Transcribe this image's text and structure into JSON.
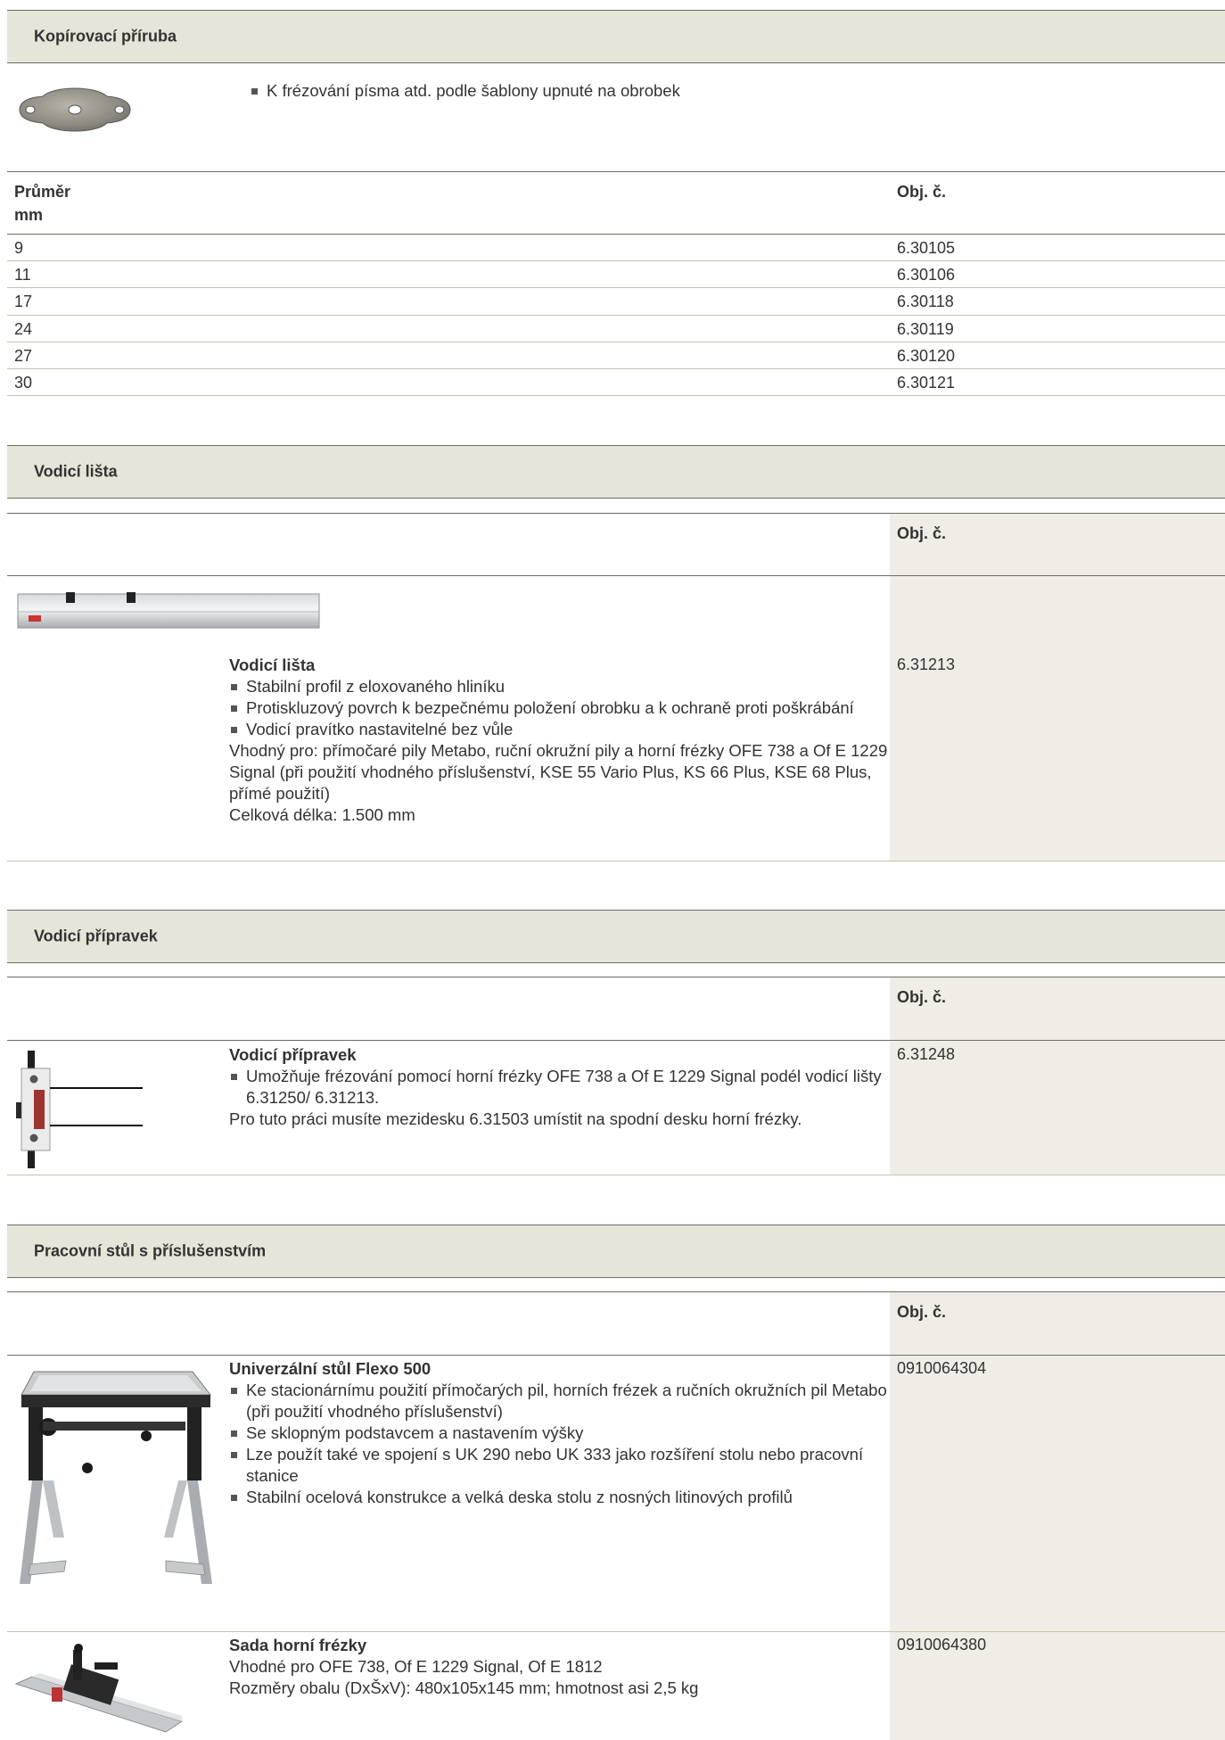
{
  "sections": {
    "copy_flange": {
      "title": "Kopírovací příruba",
      "bullet": "K frézování písma atd. podle šablony upnuté na obrobek",
      "table": {
        "headers": [
          "Průměr\nmm",
          "Obj. č."
        ],
        "header_diameter_line1": "Průměr",
        "header_diameter_line2": "mm",
        "header_order": "Obj. č.",
        "rows": [
          {
            "diameter": "9",
            "order": "6.30105"
          },
          {
            "diameter": "11",
            "order": "6.30106"
          },
          {
            "diameter": "17",
            "order": "6.30118"
          },
          {
            "diameter": "24",
            "order": "6.30119"
          },
          {
            "diameter": "27",
            "order": "6.30120"
          },
          {
            "diameter": "30",
            "order": "6.30121"
          }
        ]
      }
    },
    "guide_rail": {
      "title": "Vodicí lišta",
      "header_order": "Obj. č.",
      "product": {
        "name": "Vodicí lišta",
        "bullets": [
          "Stabilní profil z eloxovaného hliníku",
          "Protiskluzový povrch k bezpečnému položení obrobku a k ochraně proti poškrábání",
          "Vodicí pravítko nastavitelné bez vůle"
        ],
        "suitable": "Vhodný pro: přímočaré pily Metabo, ruční okružní pily a horní frézky OFE 738 a Of E 1229 Signal (při použití vhodného příslušenství, KSE 55 Vario Plus, KS 66 Plus, KSE 68 Plus, přímé použití)",
        "length": "Celková délka: 1.500 mm",
        "order": "6.31213"
      }
    },
    "guide_jig": {
      "title": "Vodicí přípravek",
      "header_order": "Obj. č.",
      "product": {
        "name": "Vodicí přípravek",
        "bullets": [
          "Umožňuje frézování pomocí horní frézky OFE 738 a Of E 1229 Signal podél vodicí lišty 6.31250/ 6.31213."
        ],
        "note": "Pro tuto práci musíte mezidesku 6.31503 umístit na spodní desku horní frézky.",
        "order": "6.31248"
      }
    },
    "work_table": {
      "title": "Pracovní stůl s příslušenstvím",
      "header_order": "Obj. č.",
      "products": [
        {
          "name": "Univerzální stůl Flexo 500",
          "bullets": [
            "Ke stacionárnímu použití přímočarých pil, horních frézek a ručních okružních pil Metabo (při použití vhodného příslušenství)",
            "Se sklopným podstavcem a nastavením výšky",
            "Lze použít také ve spojení s UK 290 nebo UK 333 jako rozšíření stolu nebo pracovní stanice",
            "Stabilní ocelová konstrukce a velká deska stolu z nosných litinových profilů"
          ],
          "order": "0910064304"
        },
        {
          "name": "Sada horní frézky",
          "line1": "Vhodné pro OFE 738, Of E 1229 Signal, Of E 1812",
          "line2": "Rozměry obalu (DxŠxV): 480x105x145 mm; hmotnost asi 2,5 kg",
          "order": "0910064380"
        }
      ]
    }
  },
  "colors": {
    "band": "#e6e5d9",
    "order_column": "#efede6",
    "rule_dark": "#6d6d66",
    "rule_light": "#c4c4b0",
    "text": "#333333"
  },
  "images": [
    "copy-flange-image",
    "guide-rail-image",
    "guide-jig-image",
    "flexo-table-image",
    "router-set-image"
  ]
}
